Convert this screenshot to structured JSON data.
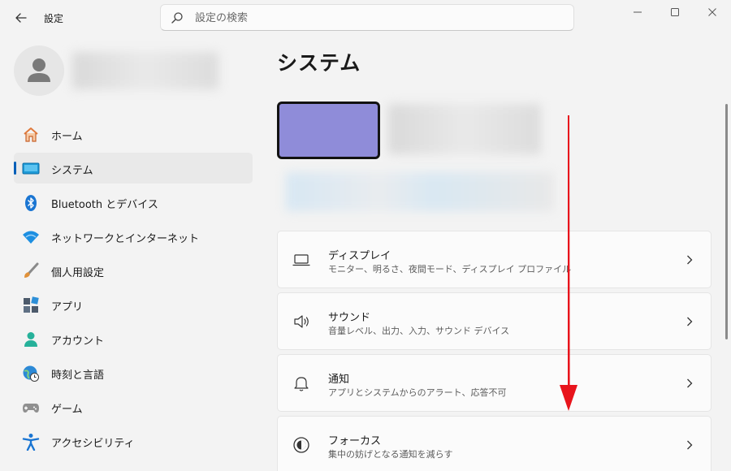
{
  "titlebar": {
    "app_title": "設定",
    "search_placeholder": "設定の検索"
  },
  "sidebar": {
    "items": [
      {
        "label": "ホーム",
        "icon": "home-icon",
        "active": false
      },
      {
        "label": "システム",
        "icon": "system-icon",
        "active": true
      },
      {
        "label": "Bluetooth とデバイス",
        "icon": "bluetooth-icon",
        "active": false
      },
      {
        "label": "ネットワークとインターネット",
        "icon": "network-icon",
        "active": false
      },
      {
        "label": "個人用設定",
        "icon": "personalization-icon",
        "active": false
      },
      {
        "label": "アプリ",
        "icon": "apps-icon",
        "active": false
      },
      {
        "label": "アカウント",
        "icon": "account-icon",
        "active": false
      },
      {
        "label": "時刻と言語",
        "icon": "time-language-icon",
        "active": false
      },
      {
        "label": "ゲーム",
        "icon": "gaming-icon",
        "active": false
      },
      {
        "label": "アクセシビリティ",
        "icon": "accessibility-icon",
        "active": false
      }
    ]
  },
  "main": {
    "title": "システム",
    "cards": [
      {
        "title": "ディスプレイ",
        "subtitle": "モニター、明るさ、夜間モード、ディスプレイ プロファイル",
        "icon": "display-icon"
      },
      {
        "title": "サウンド",
        "subtitle": "音量レベル、出力、入力、サウンド デバイス",
        "icon": "sound-icon"
      },
      {
        "title": "通知",
        "subtitle": "アプリとシステムからのアラート、応答不可",
        "icon": "notification-bell-icon"
      },
      {
        "title": "フォーカス",
        "subtitle": "集中の妨げとなる通知を減らす",
        "icon": "focus-icon"
      }
    ]
  },
  "colors": {
    "accent": "#005fb8",
    "device_thumbnail": "#8f8cd9",
    "annotation_arrow": "#e8141c"
  }
}
